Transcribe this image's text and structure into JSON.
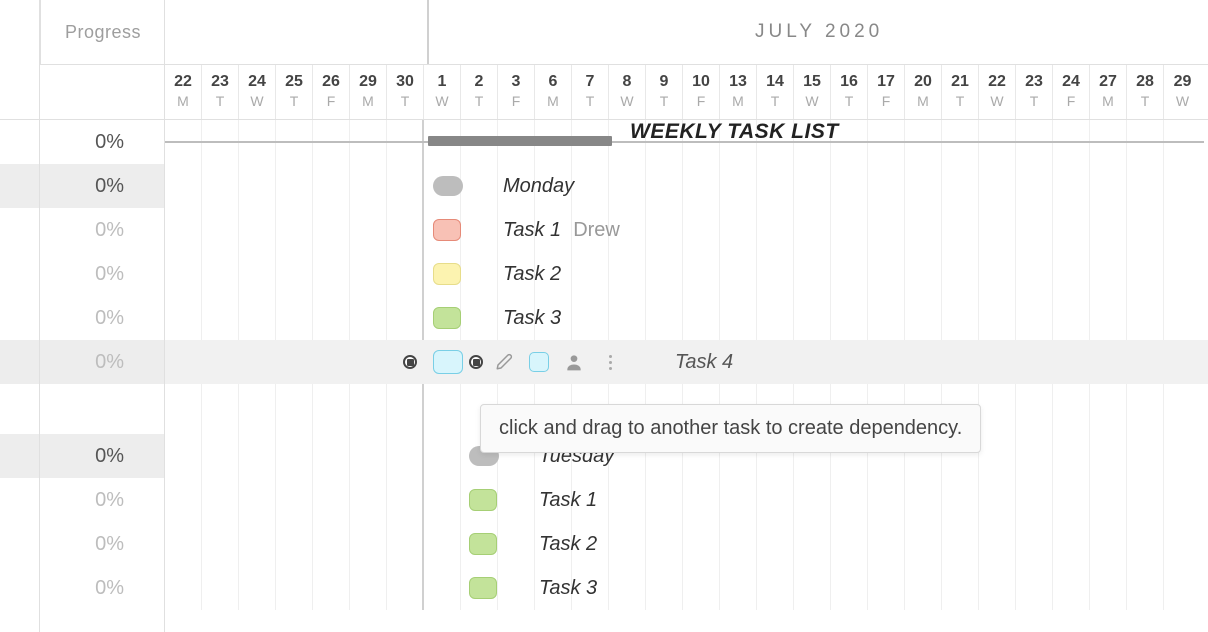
{
  "sidebar": {
    "header": "Progress"
  },
  "month": {
    "label": "JULY 2020"
  },
  "dates": [
    {
      "num": "22",
      "dow": "M"
    },
    {
      "num": "23",
      "dow": "T"
    },
    {
      "num": "24",
      "dow": "W"
    },
    {
      "num": "25",
      "dow": "T"
    },
    {
      "num": "26",
      "dow": "F"
    },
    {
      "num": "29",
      "dow": "M"
    },
    {
      "num": "30",
      "dow": "T"
    },
    {
      "num": "1",
      "dow": "W"
    },
    {
      "num": "2",
      "dow": "T"
    },
    {
      "num": "3",
      "dow": "F"
    },
    {
      "num": "6",
      "dow": "M"
    },
    {
      "num": "7",
      "dow": "T"
    },
    {
      "num": "8",
      "dow": "W"
    },
    {
      "num": "9",
      "dow": "T"
    },
    {
      "num": "10",
      "dow": "F"
    },
    {
      "num": "13",
      "dow": "M"
    },
    {
      "num": "14",
      "dow": "T"
    },
    {
      "num": "15",
      "dow": "W"
    },
    {
      "num": "16",
      "dow": "T"
    },
    {
      "num": "17",
      "dow": "F"
    },
    {
      "num": "20",
      "dow": "M"
    },
    {
      "num": "21",
      "dow": "T"
    },
    {
      "num": "22",
      "dow": "W"
    },
    {
      "num": "23",
      "dow": "T"
    },
    {
      "num": "24",
      "dow": "F"
    },
    {
      "num": "27",
      "dow": "M"
    },
    {
      "num": "28",
      "dow": "T"
    },
    {
      "num": "29",
      "dow": "W"
    }
  ],
  "header_title": "WEEKLY TASK LIST",
  "rows": [
    {
      "progress": "0%",
      "type": "header"
    },
    {
      "progress": "0%",
      "type": "day",
      "label": "Monday",
      "strong": true
    },
    {
      "progress": "0%",
      "type": "task",
      "label": "Task 1",
      "assignee": "Drew",
      "color": "red"
    },
    {
      "progress": "0%",
      "type": "task",
      "label": "Task 2",
      "color": "yellow"
    },
    {
      "progress": "0%",
      "type": "task",
      "label": "Task 3",
      "color": "green"
    },
    {
      "progress": "0%",
      "type": "task-selected",
      "label": "Task 4",
      "color": "blue"
    },
    {
      "progress": "",
      "type": "spacer"
    },
    {
      "progress": "0%",
      "type": "day",
      "label": "Tuesday",
      "strong": true,
      "offset": true
    },
    {
      "progress": "0%",
      "type": "task",
      "label": "Task 1",
      "color": "green",
      "offset": true
    },
    {
      "progress": "0%",
      "type": "task",
      "label": "Task 2",
      "color": "green",
      "offset": true
    },
    {
      "progress": "0%",
      "type": "task",
      "label": "Task 3",
      "color": "green",
      "offset": true
    }
  ],
  "tooltip": "click and drag to another task to create dependency.",
  "icons": {
    "edit": "edit-icon",
    "user": "user-icon",
    "more": "more-icon"
  }
}
